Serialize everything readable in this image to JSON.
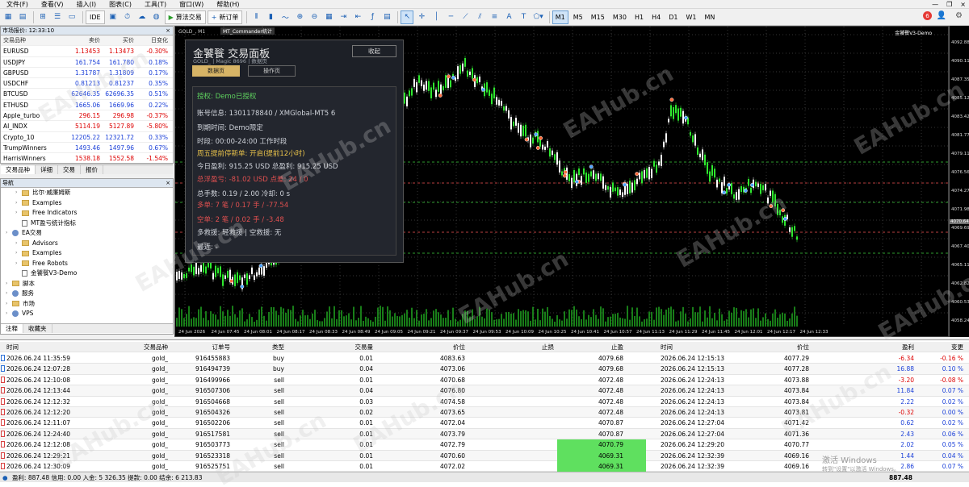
{
  "menu": [
    "文件(F)",
    "查看(V)",
    "插入(I)",
    "图表(C)",
    "工具(T)",
    "窗口(W)",
    "帮助(H)"
  ],
  "toolbar": {
    "ide": "IDE",
    "algo": "算法交易",
    "new_order": "新订单",
    "timeframes": [
      "M1",
      "M5",
      "M15",
      "M30",
      "H1",
      "H4",
      "D1",
      "W1",
      "MN"
    ],
    "active_tf": "M1",
    "notifications": "6"
  },
  "market": {
    "title": "市场报价: 12:33:10",
    "headers": [
      "交易品种",
      "卖价",
      "买价",
      "日变化"
    ],
    "rows": [
      [
        "EURUSD",
        "1.13453",
        "1.13473",
        "-0.30%"
      ],
      [
        "USDJPY",
        "161.754",
        "161.780",
        "0.18%"
      ],
      [
        "GBPUSD",
        "1.31787",
        "1.31809",
        "0.17%"
      ],
      [
        "USDCHF",
        "0.81213",
        "0.81237",
        "0.35%"
      ],
      [
        "BTCUSD",
        "62646.35",
        "62696.35",
        "0.51%"
      ],
      [
        "ETHUSD",
        "1665.06",
        "1669.96",
        "0.22%"
      ],
      [
        "Apple_turbo",
        "296.15",
        "296.98",
        "-0.37%"
      ],
      [
        "AI_INDX",
        "5114.19",
        "5127.89",
        "-5.80%"
      ],
      [
        "Crypto_10",
        "12205.22",
        "12321.72",
        "0.33%"
      ],
      [
        "TrumpWinners",
        "1493.46",
        "1497.96",
        "0.67%"
      ],
      [
        "HarrisWinners",
        "1538.18",
        "1552.58",
        "-1.54%"
      ]
    ],
    "tabs": [
      "交易品种",
      "详细",
      "交易",
      "报价"
    ]
  },
  "navigator": {
    "title": "导航",
    "items": [
      {
        "label": "比尔·威廉姆斯",
        "kind": "folder",
        "indent": 1
      },
      {
        "label": "Examples",
        "kind": "folder",
        "indent": 1
      },
      {
        "label": "Free Indicators",
        "kind": "folder",
        "indent": 1
      },
      {
        "label": "MT盈亏统计指标",
        "kind": "file",
        "indent": 1
      },
      {
        "label": "EA交易",
        "kind": "gear",
        "indent": 0
      },
      {
        "label": "Advisors",
        "kind": "folder",
        "indent": 1
      },
      {
        "label": "Examples",
        "kind": "folder",
        "indent": 1
      },
      {
        "label": "Free Robots",
        "kind": "folder",
        "indent": 1
      },
      {
        "label": "金饕餮V3-Demo",
        "kind": "file",
        "indent": 1
      },
      {
        "label": "脚本",
        "kind": "folder",
        "indent": 0
      },
      {
        "label": "服务",
        "kind": "gear",
        "indent": 0
      },
      {
        "label": "市场",
        "kind": "folder",
        "indent": 0
      },
      {
        "label": "VPS",
        "kind": "gear",
        "indent": 0
      }
    ],
    "tabs": [
      "注释",
      "收藏夹"
    ]
  },
  "chart": {
    "title": "GOLD_, M1",
    "ea_tag": "MT_Commander统计",
    "corner": "金饕餮V3-Demo",
    "current_price": "4070.64",
    "price_ticks": [
      "4092.88",
      "4090.11",
      "4087.35",
      "4085.12",
      "4083.42",
      "4081.77",
      "4079.11",
      "4076.56",
      "4074.27",
      "4071.98",
      "4069.69",
      "4067.40",
      "4065.11",
      "4062.82",
      "4060.53",
      "4058.24"
    ],
    "time_ticks": [
      "24 Jun 2026",
      "24 Jun 07:45",
      "24 Jun 08:01",
      "24 Jun 08:17",
      "24 Jun 08:33",
      "24 Jun 08:49",
      "24 Jun 09:05",
      "24 Jun 09:21",
      "24 Jun 09:37",
      "24 Jun 09:53",
      "24 Jun 10:09",
      "24 Jun 10:25",
      "24 Jun 10:41",
      "24 Jun 10:57",
      "24 Jun 11:13",
      "24 Jun 11:29",
      "24 Jun 11:45",
      "24 Jun 12:01",
      "24 Jun 12:17",
      "24 Jun 12:33"
    ],
    "colors": {
      "bull": "#2ee82e",
      "bear": "#ffffff",
      "grid": "#333333"
    }
  },
  "panel": {
    "title": "金饕餮 交易面板",
    "subtitle": "GOLD_ | Magic 8696 | 数据页",
    "collapse": "收起",
    "tab_data": "数据页",
    "tab_ops": "操作页",
    "lines": [
      {
        "text": "授权: Demo已授权",
        "cls": "green"
      },
      {
        "text": "账号信息: 1301178840 / XMGlobal-MT5 6",
        "cls": ""
      },
      {
        "text": "到期时间: Demo限定",
        "cls": ""
      },
      {
        "text": "时段: 00:00-24:00   工作时段",
        "cls": ""
      },
      {
        "text": "周五提前停新单: 开启(提前12小时)",
        "cls": "yellow"
      },
      {
        "text": "今日盈利: 915.25 USD    总盈利: 915.25 USD",
        "cls": ""
      },
      {
        "text": "总浮盈亏: -81.02 USD    点差: 24 / 0",
        "cls": "pred"
      },
      {
        "text": "总手数: 0.19 / 2.00    冷却: 0 s",
        "cls": ""
      },
      {
        "text": "多单: 7 笔 / 0.17 手 / -77.54",
        "cls": "pred"
      },
      {
        "text": "空单: 2 笔 / 0.02 手 / -3.48",
        "cls": "pred"
      },
      {
        "text": "多救援: 轻救援 | 空救援: 无",
        "cls": ""
      },
      {
        "text": "最近: -",
        "cls": ""
      }
    ]
  },
  "terminal": {
    "headers": [
      "时间",
      "交易品种",
      "订单号",
      "类型",
      "交易量",
      "价位",
      "止损",
      "止盈",
      "时间",
      "价位",
      "盈利",
      "变更"
    ],
    "rows": [
      [
        "2026.06.24 11:35:59",
        "gold_",
        "916455883",
        "buy",
        "0.01",
        "4083.63",
        "",
        "4079.68",
        "2026.06.24 12:15:13",
        "4077.29",
        "-6.34",
        "-0.16 %"
      ],
      [
        "2026.06.24 12:07:28",
        "gold_",
        "916494739",
        "buy",
        "0.04",
        "4073.06",
        "",
        "4079.68",
        "2026.06.24 12:15:13",
        "4077.28",
        "16.88",
        "0.10 %"
      ],
      [
        "2026.06.24 12:10:08",
        "gold_",
        "916499966",
        "sell",
        "0.01",
        "4070.68",
        "",
        "4072.48",
        "2026.06.24 12:24:13",
        "4073.88",
        "-3.20",
        "-0.08 %"
      ],
      [
        "2026.06.24 12:13:44",
        "gold_",
        "916507306",
        "sell",
        "0.04",
        "4076.80",
        "",
        "4072.48",
        "2026.06.24 12:24:13",
        "4073.84",
        "11.84",
        "0.07 %"
      ],
      [
        "2026.06.24 12:12:32",
        "gold_",
        "916504668",
        "sell",
        "0.03",
        "4074.58",
        "",
        "4072.48",
        "2026.06.24 12:24:13",
        "4073.84",
        "2.22",
        "0.02 %"
      ],
      [
        "2026.06.24 12:12:20",
        "gold_",
        "916504326",
        "sell",
        "0.02",
        "4073.65",
        "",
        "4072.48",
        "2026.06.24 12:24:13",
        "4073.81",
        "-0.32",
        "0.00 %"
      ],
      [
        "2026.06.24 12:11:07",
        "gold_",
        "916502206",
        "sell",
        "0.01",
        "4072.04",
        "",
        "4070.87",
        "2026.06.24 12:27:04",
        "4071.42",
        "0.62",
        "0.02 %"
      ],
      [
        "2026.06.24 12:24:40",
        "gold_",
        "916517581",
        "sell",
        "0.01",
        "4073.79",
        "",
        "4070.87",
        "2026.06.24 12:27:04",
        "4071.36",
        "2.43",
        "0.06 %"
      ],
      [
        "2026.06.24 12:12:08",
        "gold_",
        "916503773",
        "sell",
        "0.01",
        "4072.79",
        "",
        "4070.79",
        "2026.06.24 12:29:20",
        "4070.77",
        "2.02",
        "0.05 %"
      ],
      [
        "2026.06.24 12:29:21",
        "gold_",
        "916523318",
        "sell",
        "0.01",
        "4070.60",
        "",
        "4069.31",
        "2026.06.24 12:32:39",
        "4069.16",
        "1.44",
        "0.04 %"
      ],
      [
        "2026.06.24 12:30:09",
        "gold_",
        "916525751",
        "sell",
        "0.01",
        "4072.02",
        "",
        "4069.31",
        "2026.06.24 12:32:39",
        "4069.16",
        "2.86",
        "0.07 %"
      ]
    ],
    "highlight_rows": [
      8,
      9,
      10
    ],
    "summary": "盈利: 887.48  信用: 0.00  入金: 5 326.35  提款: 0.00  结余: 6 213.83",
    "total": "887.48"
  },
  "watermark": "EAHub.cn",
  "activate": {
    "line1": "激活 Windows",
    "line2": "转到\"设置\"以激活 Windows。"
  }
}
